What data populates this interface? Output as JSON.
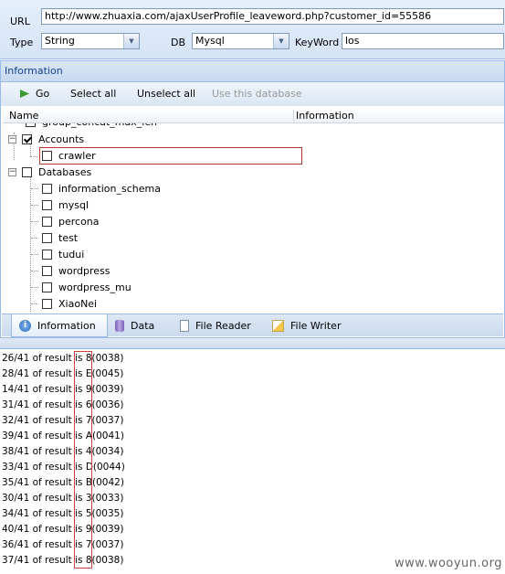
{
  "form": {
    "url_label": "URL",
    "url_value": "http://www.zhuaxia.com/ajaxUserProfile_leaveword.php?customer_id=55586",
    "type_label": "Type",
    "type_value": "String",
    "db_label": "DB",
    "db_value": "Mysql",
    "keyword_label": "KeyWord",
    "keyword_value": "los"
  },
  "panel": {
    "title": "Information",
    "toolbar": {
      "go": "Go",
      "select_all": "Select all",
      "unselect_all": "Unselect all",
      "use_db": "Use this database"
    },
    "columns": {
      "name": "Name",
      "info": "Information"
    },
    "tree": {
      "partial": "group_concat_max_len",
      "accounts": "Accounts",
      "accounts_child": "crawler",
      "databases": "Databases",
      "db_items": [
        "information_schema",
        "mysql",
        "percona",
        "test",
        "tudui",
        "wordpress",
        "wordpress_mu",
        "XiaoNei"
      ]
    },
    "tabs": [
      "Information",
      "Data",
      "File Reader",
      "File Writer"
    ]
  },
  "results": [
    "26/41 of result is 8(0038)",
    "28/41 of result is E(0045)",
    "14/41 of result is 9(0039)",
    "31/41 of result is 6(0036)",
    "32/41 of result is 7(0037)",
    "39/41 of result is A(0041)",
    "38/41 of result is 4(0034)",
    "33/41 of result is D(0044)",
    "35/41 of result is B(0042)",
    "30/41 of result is 3(0033)",
    "34/41 of result is 5(0035)",
    "40/41 of result is 9(0039)",
    "36/41 of result is 7(0037)",
    "37/41 of result is 8(0038)"
  ],
  "watermark": "www.wooyun.org",
  "colors": {
    "accent": "#15428b",
    "highlight_box": "#d04040",
    "panel_border": "#99bbe8"
  }
}
